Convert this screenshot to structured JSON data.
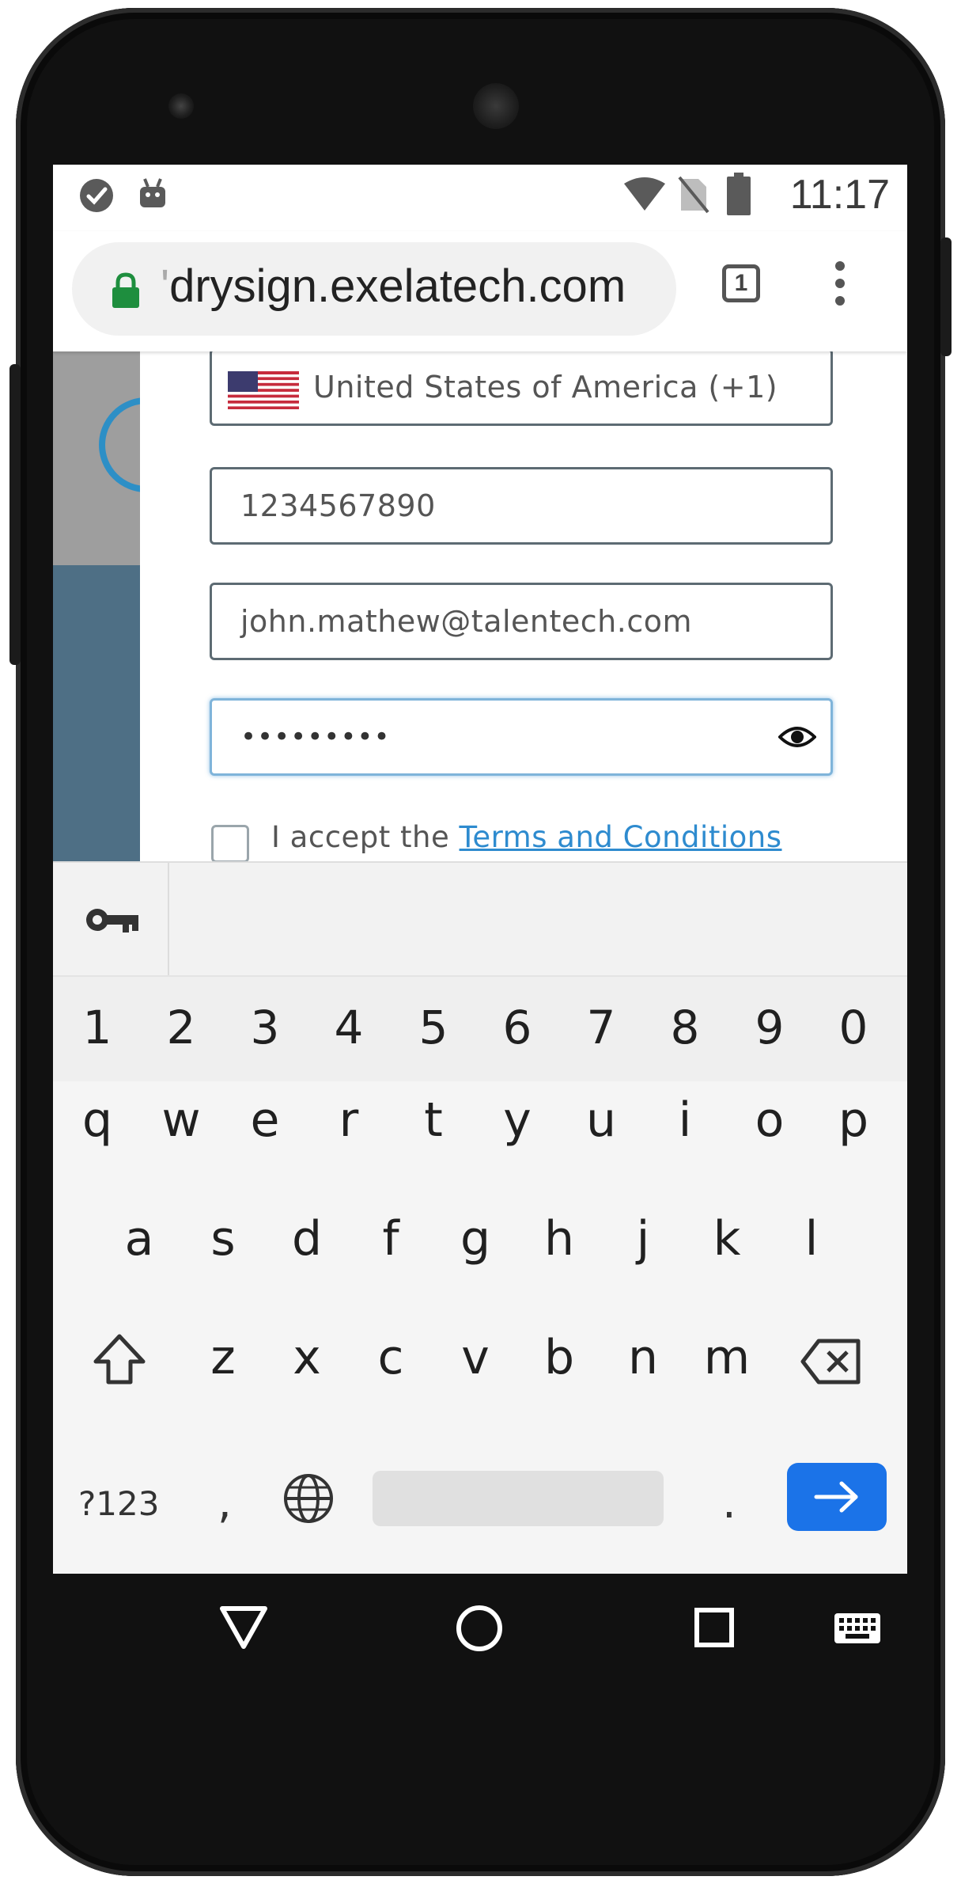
{
  "status_bar": {
    "time": "11:17",
    "icons": [
      "check-circle-icon",
      "android-icon",
      "wifi-icon",
      "no-sim-icon",
      "battery-icon"
    ]
  },
  "browser": {
    "url": "drysign.exelatech.com",
    "tab_count": "1",
    "lock_color": "#1e8e3e"
  },
  "form": {
    "country": "United States of America (+1)",
    "phone": "1234567890",
    "email": "john.mathew@talentech.com",
    "password_masked": "•••••••••",
    "accept_prefix": "I accept the ",
    "terms_link": "Terms and Conditions"
  },
  "keyboard": {
    "numbers": [
      "1",
      "2",
      "3",
      "4",
      "5",
      "6",
      "7",
      "8",
      "9",
      "0"
    ],
    "row1": [
      "q",
      "w",
      "e",
      "r",
      "t",
      "y",
      "u",
      "i",
      "o",
      "p"
    ],
    "row2": [
      "a",
      "s",
      "d",
      "f",
      "g",
      "h",
      "j",
      "k",
      "l"
    ],
    "row3": [
      "z",
      "x",
      "c",
      "v",
      "b",
      "n",
      "m"
    ],
    "symbols_label": "?123",
    "comma": ",",
    "period": ".",
    "enter_color": "#1b73e8"
  },
  "nav": {
    "items": [
      "back-icon",
      "home-icon",
      "recents-icon",
      "keyboard-icon"
    ]
  }
}
